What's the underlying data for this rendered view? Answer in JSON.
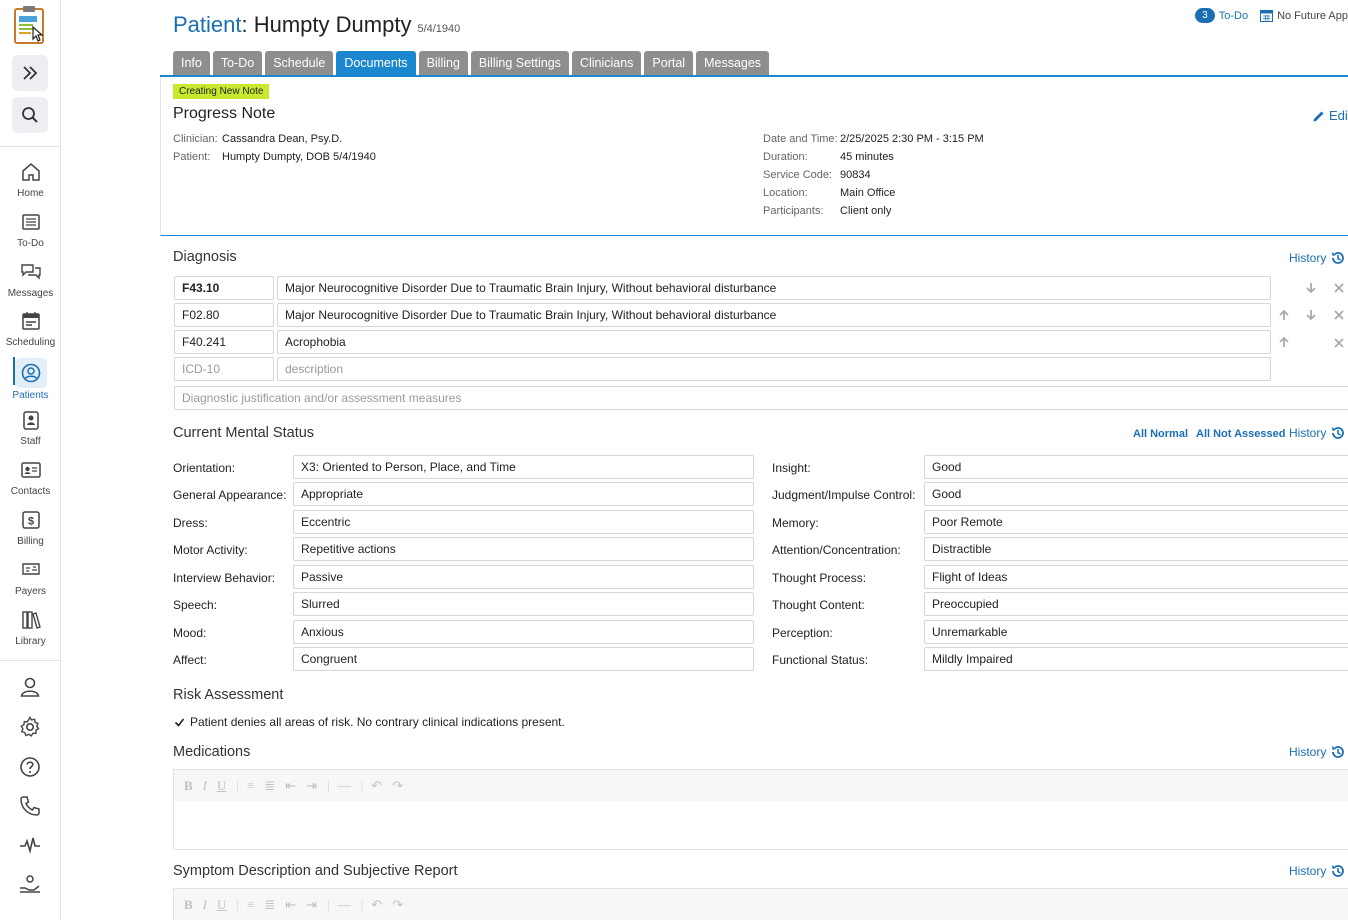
{
  "app": {
    "logo_icon": "therapy-notes-logo",
    "accent": "#1a6fb3",
    "tab_active": "#1b87cf",
    "tag_color": "#c9e92e"
  },
  "sidebar": {
    "items": [
      {
        "label": "Home",
        "icon": "home-icon"
      },
      {
        "label": "To-Do",
        "icon": "list-icon"
      },
      {
        "label": "Messages",
        "icon": "messages-icon"
      },
      {
        "label": "Scheduling",
        "icon": "calendar-icon"
      },
      {
        "label": "Patients",
        "icon": "patient-icon",
        "active": true
      },
      {
        "label": "Staff",
        "icon": "badge-icon"
      },
      {
        "label": "Contacts",
        "icon": "contact-card-icon"
      },
      {
        "label": "Billing",
        "icon": "dollar-icon"
      },
      {
        "label": "Payers",
        "icon": "check-icon"
      },
      {
        "label": "Library",
        "icon": "library-icon"
      }
    ],
    "bottom_icons": [
      "user-icon",
      "gear-icon",
      "help-icon",
      "phone-icon",
      "pulse-icon",
      "hand-care-icon"
    ]
  },
  "header": {
    "title_prefix": "Patient",
    "title_sep": ": ",
    "patient_name": "Humpty Dumpty",
    "dob": "5/4/1940",
    "todo_count": "3",
    "todo_label": "To-Do",
    "no_future_label": "No Future App"
  },
  "tabs": [
    "Info",
    "To-Do",
    "Schedule",
    "Documents",
    "Billing",
    "Billing Settings",
    "Clinicians",
    "Portal",
    "Messages"
  ],
  "note": {
    "tag": "Creating New Note",
    "title": "Progress Note",
    "edit_label": "Edit",
    "left": [
      {
        "k": "Clinician:",
        "v": "Cassandra Dean, Psy.D."
      },
      {
        "k": "Patient:",
        "v": "Humpty Dumpty, DOB 5/4/1940"
      }
    ],
    "right": [
      {
        "k": "Date and Time:",
        "v": "2/25/2025 2:30 PM - 3:15 PM"
      },
      {
        "k": "Duration:",
        "v": "45 minutes"
      },
      {
        "k": "Service Code:",
        "v": "90834"
      },
      {
        "k": "Location:",
        "v": "Main Office"
      },
      {
        "k": "Participants:",
        "v": "Client only"
      }
    ]
  },
  "diagnosis": {
    "title": "Diagnosis",
    "history": "History",
    "rows": [
      {
        "code": "F43.10",
        "desc": "Major Neurocognitive Disorder Due to Traumatic Brain Injury, Without behavioral disturbance"
      },
      {
        "code": "F02.80",
        "desc": "Major Neurocognitive Disorder Due to Traumatic Brain Injury, Without behavioral disturbance"
      },
      {
        "code": "F40.241",
        "desc": "Acrophobia"
      }
    ],
    "code_placeholder": "ICD-10",
    "desc_placeholder": "description",
    "justification_placeholder": "Diagnostic justification and/or assessment measures"
  },
  "mental_status": {
    "title": "Current Mental Status",
    "all_normal": "All Normal",
    "all_not_assessed": "All Not Assessed",
    "history": "History",
    "left": [
      {
        "k": "Orientation:",
        "v": "X3: Oriented to Person, Place, and Time"
      },
      {
        "k": "General Appearance:",
        "v": "Appropriate"
      },
      {
        "k": "Dress:",
        "v": "Eccentric"
      },
      {
        "k": "Motor Activity:",
        "v": "Repetitive actions"
      },
      {
        "k": "Interview Behavior:",
        "v": "Passive"
      },
      {
        "k": "Speech:",
        "v": "Slurred"
      },
      {
        "k": "Mood:",
        "v": "Anxious"
      },
      {
        "k": "Affect:",
        "v": "Congruent"
      }
    ],
    "right": [
      {
        "k": "Insight:",
        "v": "Good"
      },
      {
        "k": "Judgment/Impulse Control:",
        "v": "Good"
      },
      {
        "k": "Memory:",
        "v": "Poor Remote"
      },
      {
        "k": "Attention/Concentration:",
        "v": "Distractible"
      },
      {
        "k": "Thought Process:",
        "v": "Flight of Ideas"
      },
      {
        "k": "Thought Content:",
        "v": "Preoccupied"
      },
      {
        "k": "Perception:",
        "v": "Unremarkable"
      },
      {
        "k": "Functional Status:",
        "v": "Mildly Impaired"
      }
    ]
  },
  "risk": {
    "title": "Risk Assessment",
    "checkbox_label": "Patient denies all areas of risk. No contrary clinical indications present.",
    "checked": true
  },
  "medications": {
    "title": "Medications",
    "history": "History"
  },
  "symptoms": {
    "title": "Symptom Description and Subjective Report",
    "history": "History"
  },
  "toolbar_buttons": [
    "bold",
    "italic",
    "underline",
    "numbered-list",
    "bullet-list",
    "outdent",
    "indent",
    "horizontal-rule",
    "undo",
    "redo"
  ]
}
